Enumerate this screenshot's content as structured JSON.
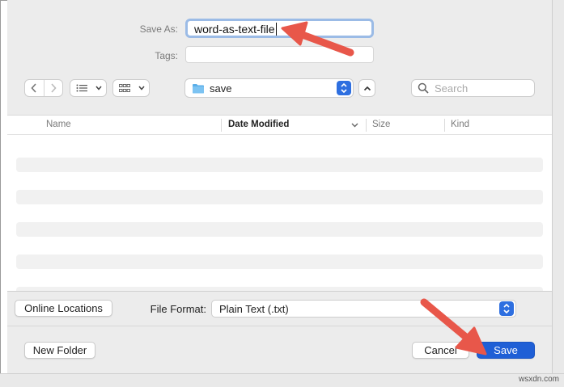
{
  "save_as": {
    "label": "Save As:",
    "value": "word-as-text-file"
  },
  "tags": {
    "label": "Tags:",
    "value": ""
  },
  "toolbar": {
    "back_icon": "chevron-left-icon",
    "forward_icon": "chevron-right-icon",
    "list_view_icon": "list-view-icon",
    "grid_view_icon": "grid-view-icon",
    "folder_name": "save",
    "search_placeholder": "Search"
  },
  "columns": {
    "name": "Name",
    "date_modified": "Date Modified",
    "size": "Size",
    "kind": "Kind"
  },
  "options": {
    "online_locations": "Online Locations",
    "file_format_label": "File Format:",
    "file_format_value": "Plain Text (.txt)"
  },
  "footer": {
    "new_folder": "New Folder",
    "cancel": "Cancel",
    "save": "Save"
  },
  "colors": {
    "accent": "#1f5fd6",
    "focus_ring": "#9bbbe6",
    "annotation_arrow": "#e8574a"
  },
  "watermark": "wsxdn.com"
}
